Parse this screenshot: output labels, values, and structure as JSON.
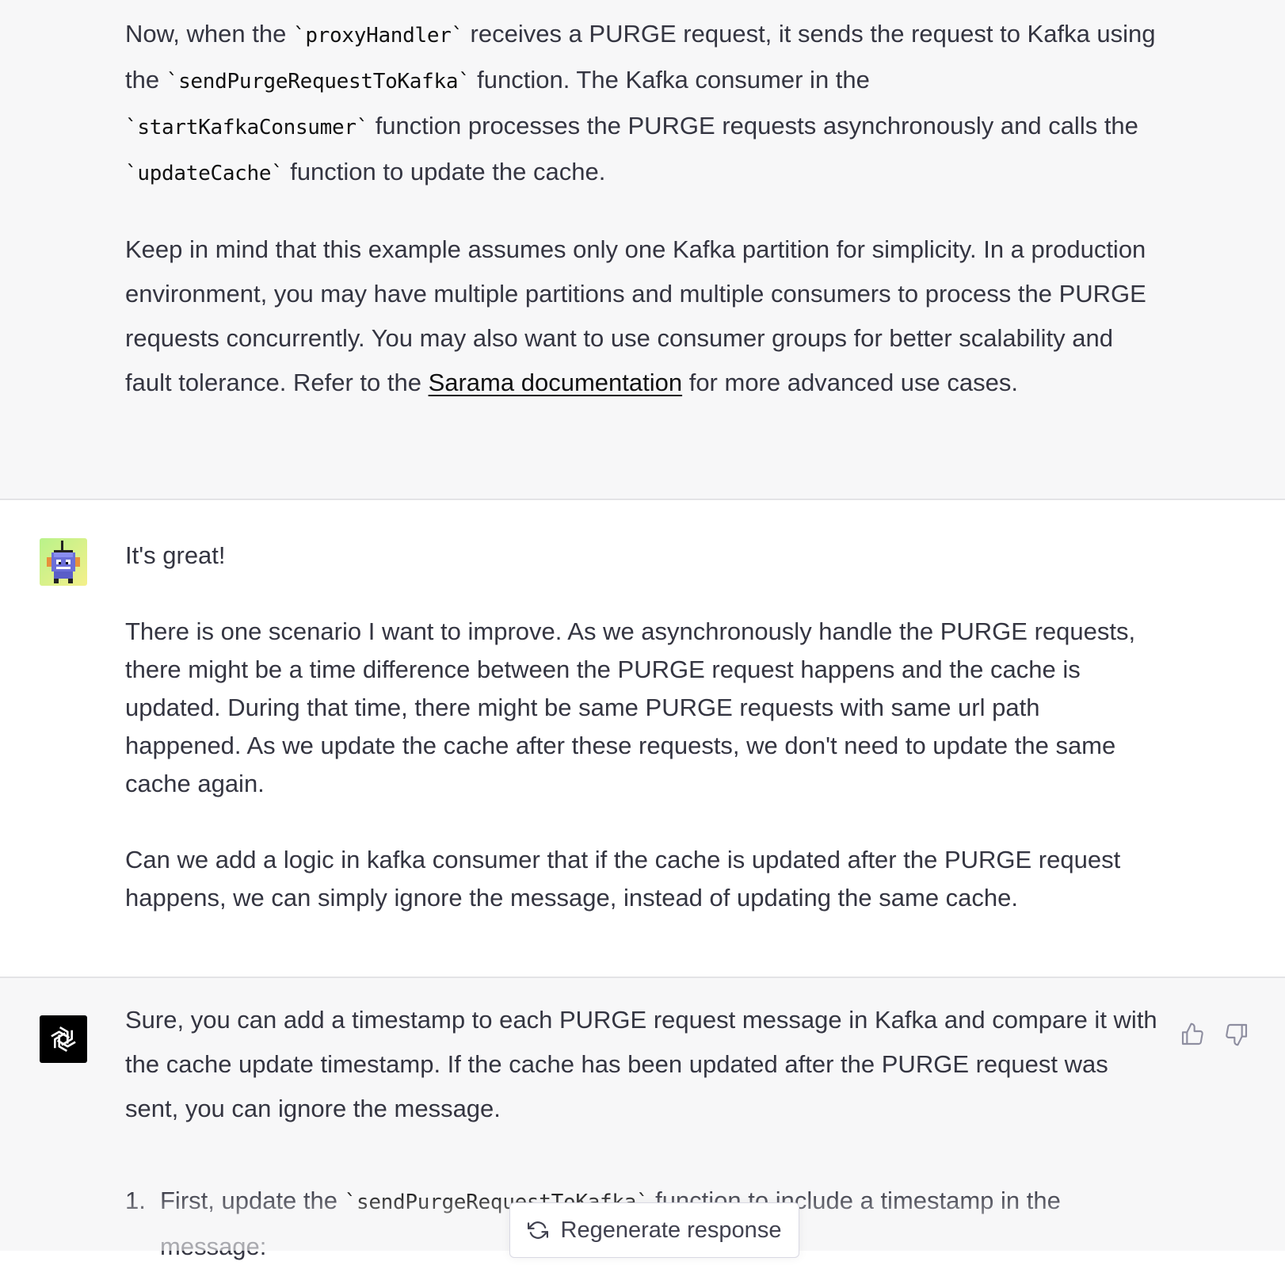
{
  "messages": {
    "assistant_prev": {
      "p1": {
        "t1": "Now, when the ",
        "c1": "`proxyHandler`",
        "t2": " receives a PURGE request, it sends the request to Kafka using the ",
        "c2": "`sendPurgeRequestToKafka`",
        "t3": " function. The Kafka consumer in the ",
        "c3": "`startKafkaConsumer`",
        "t4": " function processes the PURGE requests asynchronously and calls the ",
        "c4": "`updateCache`",
        "t5": " function to update the cache."
      },
      "p2": {
        "t1": "Keep in mind that this example assumes only one Kafka partition for simplicity. In a production environment, you may have multiple partitions and multiple consumers to process the PURGE requests concurrently. You may also want to use consumer groups for better scalability and fault tolerance. Refer to the ",
        "link": "Sarama documentation",
        "t2": " for more advanced use cases."
      }
    },
    "user": {
      "p1": "It's great!",
      "p2": "There is one scenario I want to improve. As we asynchronously handle the PURGE requests, there might be a time difference between the PURGE request happens and the cache is updated. During that time, there might be same PURGE requests with same url path happened. As we update the cache after these requests, we don't need to update the same cache again.",
      "p3": "Can we add a logic in kafka consumer that if the cache is updated after the PURGE request happens, we can simply ignore the message, instead of updating the same cache."
    },
    "assistant": {
      "p1": "Sure, you can add a timestamp to each PURGE request message in Kafka and compare it with the cache update timestamp. If the cache has been updated after the PURGE request was sent, you can ignore the message.",
      "list_item_1": {
        "num": "1.",
        "t1": "First, update the ",
        "c1": "`sendPurgeRequestToKafka`",
        "t2": " function to include a timestamp in the message:"
      }
    }
  },
  "feedback": {
    "thumbs_up_icon": "thumbs-up-icon",
    "thumbs_down_icon": "thumbs-down-icon"
  },
  "regenerate": {
    "label": "Regenerate response",
    "icon": "refresh-icon"
  },
  "colors": {
    "assistant_bg": "#f7f7f8",
    "user_bg": "#ffffff",
    "bot_avatar_bg": "#000000",
    "text": "#343541"
  }
}
